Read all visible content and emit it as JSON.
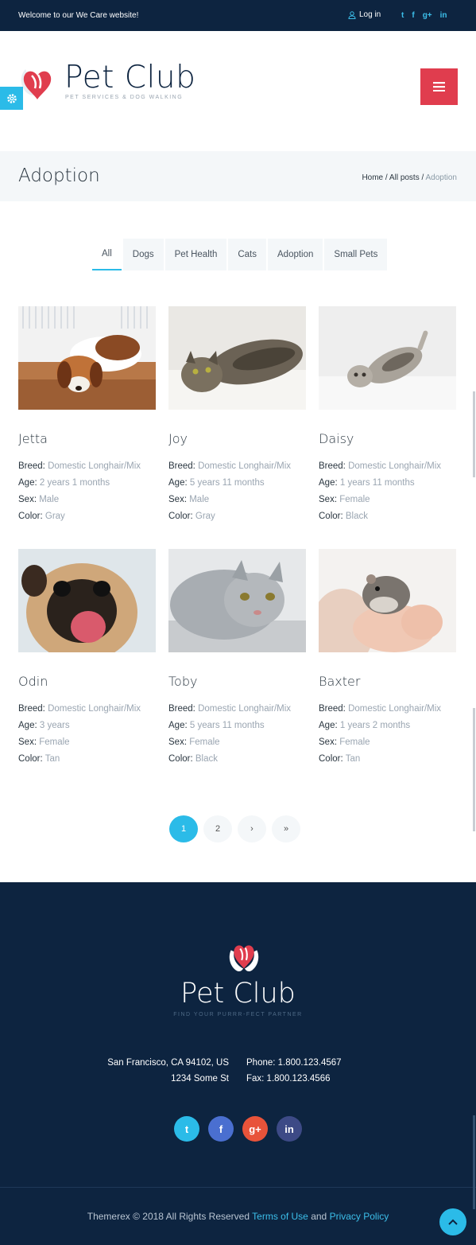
{
  "topbar": {
    "welcome": "Welcome to our We Care website!",
    "login_label": "Log in",
    "social_icons": [
      "twitter-icon",
      "facebook-icon",
      "google-plus-icon",
      "linkedin-icon"
    ]
  },
  "header": {
    "logo_title": "Pet Club",
    "logo_tagline": "PET SERVICES & DOG WALKING",
    "menu_icon": "hamburger-icon"
  },
  "title_bar": {
    "title": "Adoption",
    "breadcrumb": {
      "home": "Home",
      "sep1": " / ",
      "posts": "All posts",
      "sep2": " / ",
      "current": "Adoption"
    }
  },
  "filters": [
    "All",
    "Dogs",
    "Pet Health",
    "Cats",
    "Adoption",
    "Small Pets"
  ],
  "pets": [
    {
      "name": "Jetta",
      "breed": "Domestic Longhair/Mix",
      "age": "2 years 1 months",
      "sex": "Male",
      "color": "Gray"
    },
    {
      "name": "Joy",
      "breed": "Domestic Longhair/Mix",
      "age": "5 years 11 months",
      "sex": "Male",
      "color": "Gray"
    },
    {
      "name": "Daisy",
      "breed": "Domestic Longhair/Mix",
      "age": "1 years 11 months",
      "sex": "Female",
      "color": "Black"
    },
    {
      "name": "Odin",
      "breed": "Domestic Longhair/Mix",
      "age": "3 years",
      "sex": "Female",
      "color": "Tan"
    },
    {
      "name": "Toby",
      "breed": "Domestic Longhair/Mix",
      "age": "5 years 11 months",
      "sex": "Female",
      "color": "Black"
    },
    {
      "name": "Baxter",
      "breed": "Domestic Longhair/Mix",
      "age": "1 years 2 months",
      "sex": "Female",
      "color": "Tan"
    }
  ],
  "labels": {
    "breed": "Breed:",
    "age": "Age:",
    "sex": "Sex:",
    "color": "Color:"
  },
  "pagination": [
    "1",
    "2",
    "›",
    "»"
  ],
  "footer": {
    "logo_title": "Pet Club",
    "logo_tagline": "FIND YOUR PURRR-FECT PARTNER",
    "address_line1": "San Francisco, CA 94102, US",
    "address_line2": "1234 Some St",
    "phone": "Phone: 1.800.123.4567",
    "fax": "Fax: 1.800.123.4566"
  },
  "copyright": {
    "text": "Themerex © 2018 All Rights Reserved",
    "terms": "Terms of Use",
    "and": "and",
    "privacy": "Privacy Policy"
  },
  "colors": {
    "navy": "#0d2440",
    "accent_blue": "#2bbbe8",
    "accent_red": "#e03d4e",
    "light_bg": "#f4f7f9"
  }
}
